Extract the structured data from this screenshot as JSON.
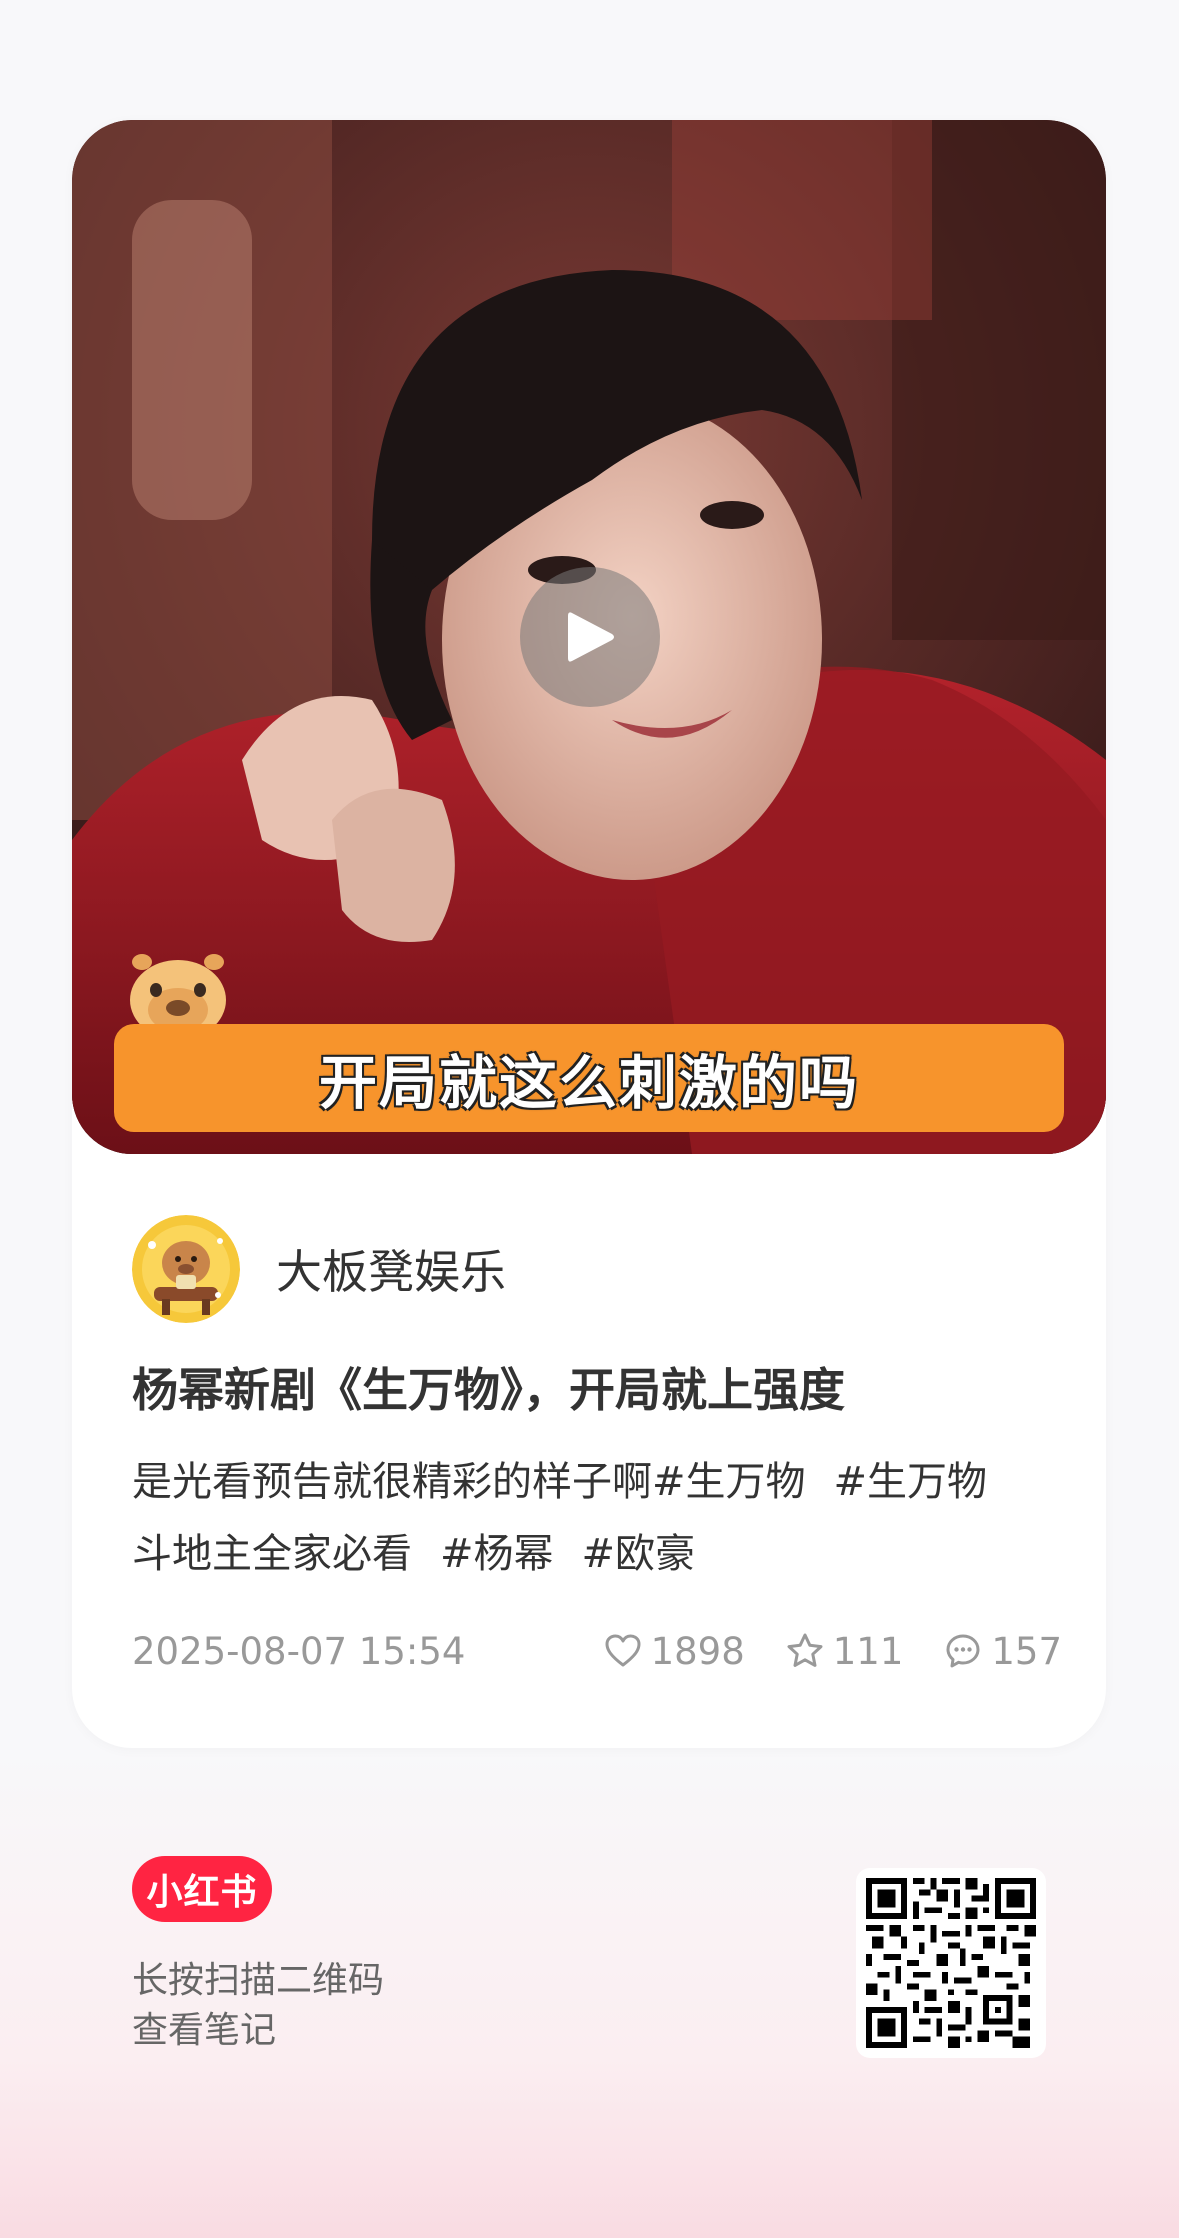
{
  "cover": {
    "subtitle": "开局就这么刺激的吗",
    "play_icon": "play-icon",
    "sticker_icon": "capybara-sticker"
  },
  "author": {
    "name": "大板凳娱乐",
    "avatar_icon": "capybara-avatar"
  },
  "note": {
    "title": "杨幂新剧《生万物》，开局就上强度",
    "desc_line1_text": "是光看预告就很精彩的样子啊",
    "desc_line1_tag1": "#生万物",
    "desc_line1_tag2": "#生万物",
    "desc_line2_text": "斗地主全家必看",
    "desc_line2_tag1": "#杨幂",
    "desc_line2_tag2": "#欧豪"
  },
  "meta": {
    "date": "2025-08-07 15:54",
    "likes": "1898",
    "collects": "111",
    "comments": "157",
    "like_icon": "heart-icon",
    "collect_icon": "star-icon",
    "comment_icon": "comment-icon"
  },
  "footer": {
    "brand": "小红书",
    "scan_line1": "长按扫描二维码",
    "scan_line2": "查看笔记"
  },
  "colors": {
    "brand_red": "#ff2442",
    "subtitle_orange": "#f7942c",
    "meta_gray": "#999999"
  }
}
